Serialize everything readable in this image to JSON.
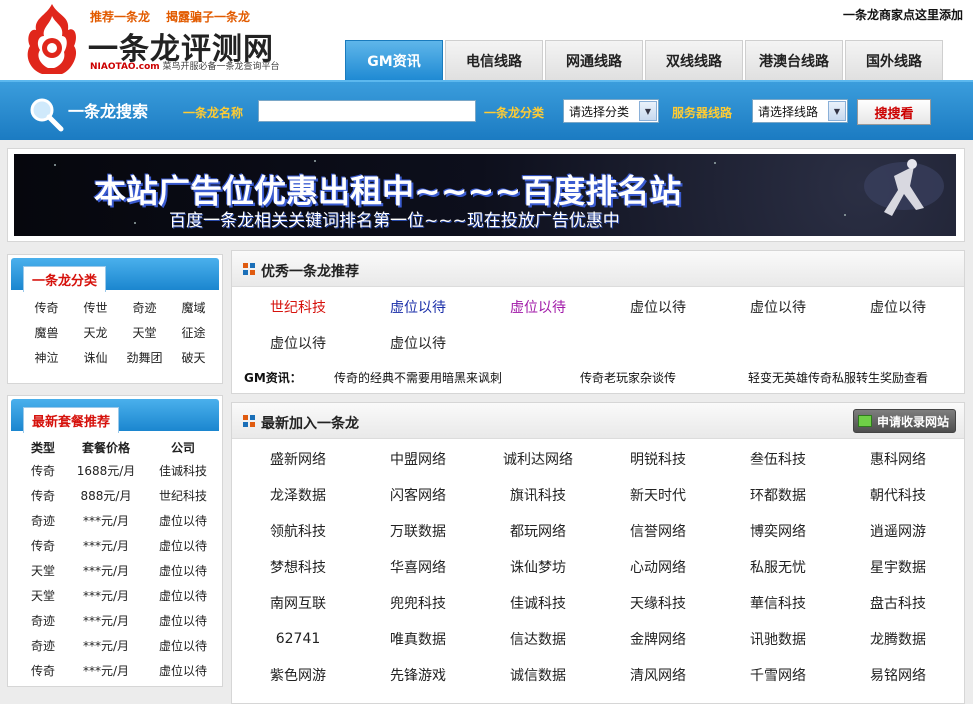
{
  "header": {
    "slogans": [
      "推荐一条龙",
      "揭露骗子一条龙"
    ],
    "logo_title": "一条龙评测网",
    "logo_site": "NIAOTAO.com",
    "logo_sub": "菜鸟开服必备一条龙查询平台",
    "top_link": "一条龙商家点这里添加",
    "tabs": [
      "GM资讯",
      "电信线路",
      "网通线路",
      "双线线路",
      "港澳台线路",
      "国外线路"
    ]
  },
  "search": {
    "title": "一条龙搜索",
    "name_label": "一条龙名称",
    "name_value": "",
    "category_label": "一条龙分类",
    "category_value": "请选择分类",
    "server_label": "服务器线路",
    "server_value": "请选择线路",
    "button": "搜搜看"
  },
  "banner": {
    "line1": "本站广告位优惠出租中~~~~百度排名站",
    "line2": "百度一条龙相关关键词排名第一位~~~现在投放广告优惠中"
  },
  "categories": {
    "title": "一条龙分类",
    "items": [
      "传奇",
      "传世",
      "奇迹",
      "魔域",
      "魔兽",
      "天龙",
      "天堂",
      "征途",
      "神泣",
      "诛仙",
      "劲舞团",
      "破天"
    ]
  },
  "packages": {
    "title": "最新套餐推荐",
    "headers": [
      "类型",
      "套餐价格",
      "公司"
    ],
    "rows": [
      [
        "传奇",
        "1688元/月",
        "佳诚科技"
      ],
      [
        "传奇",
        "888元/月",
        "世纪科技"
      ],
      [
        "奇迹",
        "***元/月",
        "虚位以待"
      ],
      [
        "传奇",
        "***元/月",
        "虚位以待"
      ],
      [
        "天堂",
        "***元/月",
        "虚位以待"
      ],
      [
        "天堂",
        "***元/月",
        "虚位以待"
      ],
      [
        "奇迹",
        "***元/月",
        "虚位以待"
      ],
      [
        "奇迹",
        "***元/月",
        "虚位以待"
      ],
      [
        "传奇",
        "***元/月",
        "虚位以待"
      ]
    ]
  },
  "recommended": {
    "title": "优秀一条龙推荐",
    "items": [
      {
        "label": "世纪科技",
        "color": "red"
      },
      {
        "label": "虚位以待",
        "color": "blue"
      },
      {
        "label": "虚位以待",
        "color": "purple"
      },
      {
        "label": "虚位以待",
        "color": "default"
      },
      {
        "label": "虚位以待",
        "color": "default"
      },
      {
        "label": "虚位以待",
        "color": "default"
      },
      {
        "label": "虚位以待",
        "color": "default"
      },
      {
        "label": "虚位以待",
        "color": "default"
      }
    ],
    "gm_label": "GM资讯：",
    "gm_news": [
      "传奇的经典不需要用暗黑来讽刺",
      "传奇老玩家杂谈传",
      "轻变无英雄传奇私服转生奖励查看"
    ]
  },
  "latest": {
    "title": "最新加入一条龙",
    "apply_button": "申请收录网站",
    "items": [
      "盛新网络",
      "中盟网络",
      "诚利达网络",
      "明锐科技",
      "叁伍科技",
      "惠科网络",
      "龙泽数据",
      "闪客网络",
      "旗讯科技",
      "新天时代",
      "环都数据",
      "朝代科技",
      "领航科技",
      "万联数据",
      "都玩网络",
      "信誉网络",
      "博奕网络",
      "逍遥网游",
      "梦想科技",
      "华喜网络",
      "诛仙梦坊",
      "心动网络",
      "私服无忧",
      "星宇数据",
      "南网互联",
      "兜兜科技",
      "佳诚科技",
      "天缘科技",
      "華信科技",
      "盘古科技",
      "62741",
      "唯真数据",
      "信达数据",
      "金牌网络",
      "讯驰数据",
      "龙腾数据",
      "紫色网游",
      "先锋游戏",
      "诚信数据",
      "清风网络",
      "千雪网络",
      "易铭网络"
    ]
  }
}
